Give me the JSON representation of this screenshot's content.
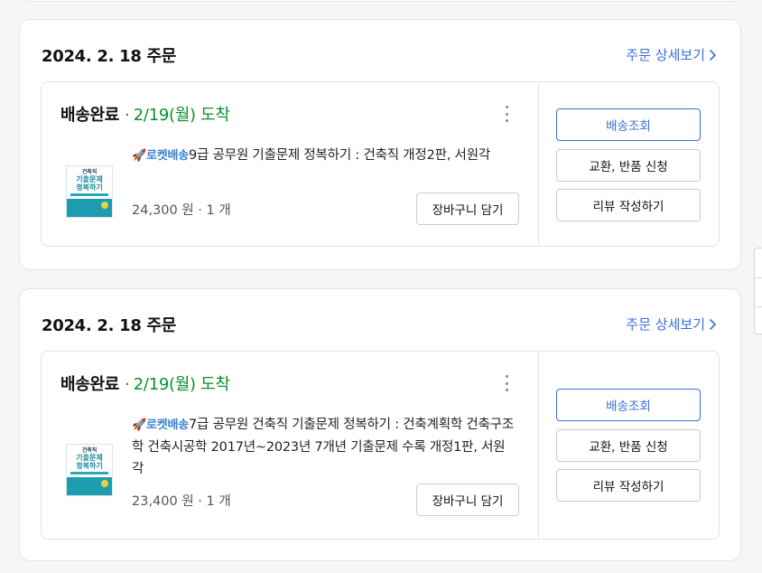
{
  "orders": [
    {
      "date": "2024. 2. 18 주문",
      "detail_link": "주문 상세보기",
      "status": "배송완료",
      "arrival": "2/19(월) 도착",
      "product": {
        "badge": "🚀로켓배송",
        "title": "9급 공무원 기출문제 정복하기 : 건축직 개정2판, 서원각",
        "price": "24,300 원 · 1 개",
        "cover_lines": [
          "건축직",
          "기출문제",
          "정복하기"
        ]
      },
      "cart_button": "장바구니 담기",
      "actions": [
        "배송조회",
        "교환, 반품 신청",
        "리뷰 작성하기"
      ]
    },
    {
      "date": "2024. 2. 18 주문",
      "detail_link": "주문 상세보기",
      "status": "배송완료",
      "arrival": "2/19(월) 도착",
      "product": {
        "badge": "🚀로켓배송",
        "title": "7급 공무원 건축직 기출문제 정복하기 : 건축계획학 건축구조학 건축시공학 2017년~2023년 7개년 기출문제 수록 개정1판, 서원각",
        "price": "23,400 원 · 1 개",
        "cover_lines": [
          "건축직",
          "기출문제",
          "정복하기"
        ]
      },
      "cart_button": "장바구니 담기",
      "actions": [
        "배송조회",
        "교환, 반품 신청",
        "리뷰 작성하기"
      ]
    }
  ],
  "colors": {
    "accent": "#3a6fd8",
    "arrival_green": "#0a8f2a",
    "rocket_blue": "#3a82d0"
  }
}
